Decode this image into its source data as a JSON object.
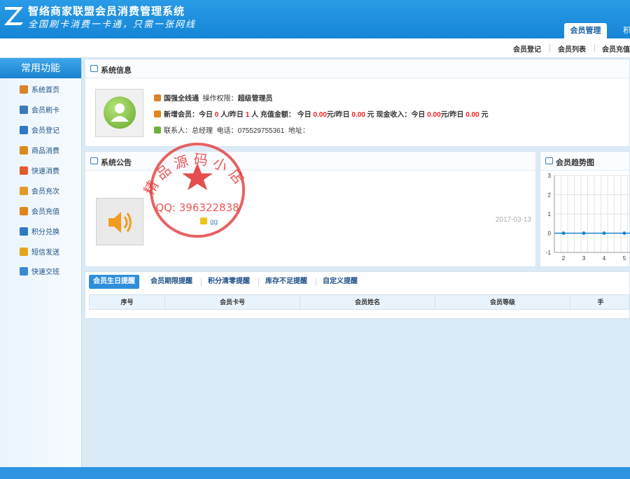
{
  "header": {
    "app_title": "智络商家联盟会员消费管理系统",
    "slogan": "全国刷卡消费一卡通，只需一张网线",
    "tabs": [
      {
        "label": "会员管理",
        "active": true
      },
      {
        "label": "积",
        "active": false
      }
    ]
  },
  "subnav": {
    "links": [
      "会员登记",
      "会员列表",
      "会员充值"
    ]
  },
  "sidebar": {
    "title": "常用功能",
    "items": [
      {
        "label": "系统首页",
        "icon": "home-icon",
        "color": "#d9822b"
      },
      {
        "label": "会员刷卡",
        "icon": "user-card-icon",
        "color": "#3d7ab8"
      },
      {
        "label": "会员登记",
        "icon": "user-add-icon",
        "color": "#2f78c4"
      },
      {
        "label": "商品消费",
        "icon": "cart-icon",
        "color": "#d98a1f"
      },
      {
        "label": "快速消费",
        "icon": "fast-pay-icon",
        "color": "#e25b2f"
      },
      {
        "label": "会员充次",
        "icon": "recharge-times-icon",
        "color": "#e29a27"
      },
      {
        "label": "会员充值",
        "icon": "recharge-icon",
        "color": "#e0861c"
      },
      {
        "label": "积分兑换",
        "icon": "points-icon",
        "color": "#2f78c4"
      },
      {
        "label": "短信发送",
        "icon": "sms-icon",
        "color": "#e5a51e"
      },
      {
        "label": "快速交班",
        "icon": "handover-icon",
        "color": "#3a8ad0"
      }
    ]
  },
  "system_info": {
    "title": "系统信息",
    "line1": {
      "shop": "国强全线通",
      "perm_label": "操作权限：",
      "perm_value": "超级管理员"
    },
    "line2": {
      "new_members_label": "新增会员：今日",
      "new_today": "0",
      "new_mid": "人/昨日",
      "new_yesterday": "1",
      "new_unit": "人",
      "recharge_label": "充值金额： 今日",
      "recharge_today": "0.00",
      "recharge_mid": "元/昨日",
      "recharge_yesterday": "0.00",
      "recharge_unit": "元",
      "cash_label": "现金收入：今日",
      "cash_today": "0.00",
      "cash_mid": "元/昨日",
      "cash_yesterday": "0.00",
      "cash_unit": "元"
    },
    "line3": {
      "contact_label": "联系人：总经理",
      "phone_label": "电话：",
      "phone_value": "075529755361",
      "address_label": "地址："
    }
  },
  "notice": {
    "title": "系统公告",
    "item": "gg",
    "date": "2017-03-13"
  },
  "trend": {
    "title": "会员趋势图"
  },
  "chart_data": {
    "type": "line",
    "title": "",
    "x": [
      2,
      3,
      4,
      5
    ],
    "series": [
      {
        "values": [
          0,
          0,
          0,
          0
        ]
      }
    ],
    "ylim": [
      -1,
      3
    ],
    "yticks": [
      "3",
      "2",
      "1",
      "0",
      "-1"
    ],
    "grid": true,
    "color": "#1b86d6"
  },
  "reminders": {
    "tabs": [
      {
        "label": "会员生日提醒",
        "active": true
      },
      {
        "label": "会员期限提醒",
        "active": false
      },
      {
        "label": "积分清零提醒",
        "active": false
      },
      {
        "label": "库存不足提醒",
        "active": false
      },
      {
        "label": "自定义提醒",
        "active": false
      }
    ],
    "columns": [
      "序号",
      "会员卡号",
      "会员姓名",
      "会员等级",
      "手"
    ]
  },
  "stamp": {
    "text_top": "精品源码小店",
    "qq": "QQ: 396322838",
    "color": "#e23b3b"
  }
}
